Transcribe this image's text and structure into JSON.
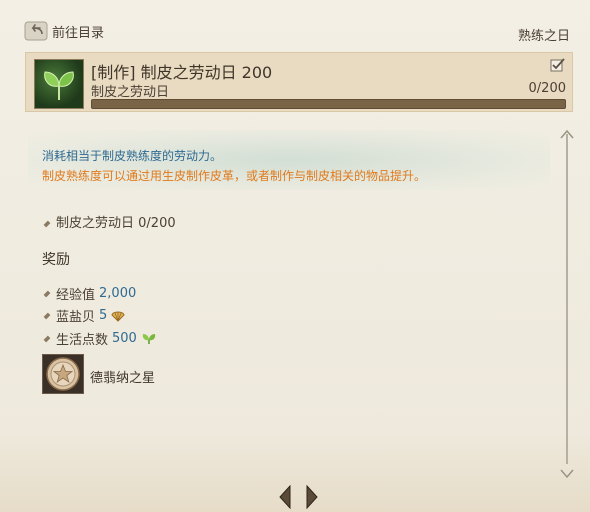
{
  "header": {
    "back_label": "前往目录",
    "right_label": "熟练之日"
  },
  "quest": {
    "title": "[制作] 制皮之劳动日 200",
    "subtitle": "制皮之劳动日",
    "progress_text": "0/200",
    "progress_fraction": 0,
    "icon": "sprout-icon",
    "check_icon": "checkbox-checked-icon"
  },
  "description": {
    "line1": "消耗相当于制皮熟练度的劳动力。",
    "line2": "制皮熟练度可以通过用生皮制作皮革，或者制作与制皮相关的物品提升。"
  },
  "objective": {
    "label": "制皮之劳动日",
    "value": "0/200"
  },
  "rewards": {
    "heading": "奖励",
    "items": [
      {
        "label": "经验值",
        "value": "2,000",
        "icon": ""
      },
      {
        "label": "蓝盐贝",
        "value": "5",
        "icon": "shell-icon"
      },
      {
        "label": "生活点数",
        "value": "500",
        "icon": "leaf-icon"
      }
    ],
    "item_reward": {
      "name": "德翡纳之星",
      "icon": "star-medal-icon"
    }
  },
  "colors": {
    "accent_blue": "#2e6a91",
    "accent_orange": "#e07a1d",
    "card_bg": "#e9dbc1"
  }
}
